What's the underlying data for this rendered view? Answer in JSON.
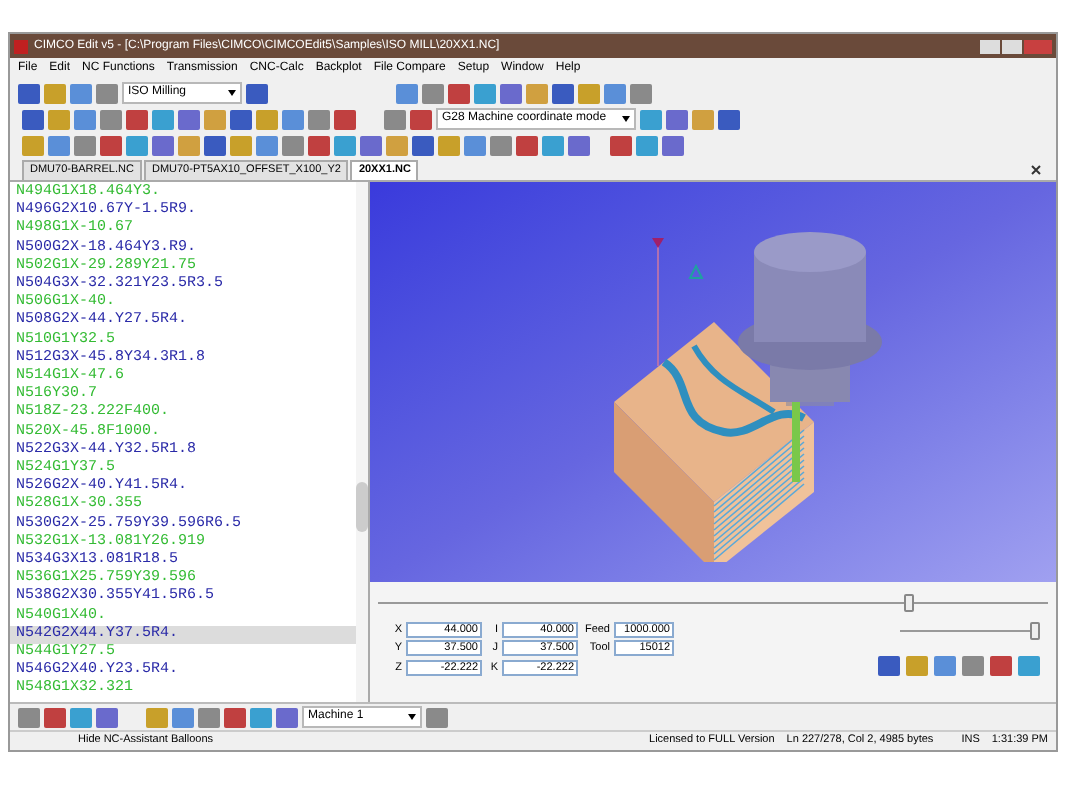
{
  "window": {
    "title": "CIMCO Edit v5 - [C:\\Program Files\\CIMCO\\CIMCOEdit5\\Samples\\ISO MILL\\20XX1.NC]"
  },
  "menu": [
    "File",
    "Edit",
    "NC Functions",
    "Transmission",
    "CNC-Calc",
    "Backplot",
    "File Compare",
    "Setup",
    "Window",
    "Help"
  ],
  "toolbar": {
    "machine_type": "ISO Milling",
    "coordinate_mode": "G28 Machine coordinate mode"
  },
  "tabs": [
    {
      "label": "DMU70-BARREL.NC",
      "selected": false
    },
    {
      "label": "DMU70-PT5AX10_OFFSET_X100_Y2",
      "selected": false
    },
    {
      "label": "20XX1.NC",
      "selected": true
    }
  ],
  "code_lines": [
    {
      "text": "N494G1X18.464Y3.",
      "color": "#33bb33",
      "selected": false
    },
    {
      "text": "N496G2X10.67Y-1.5R9.",
      "color": "#2a2aa8",
      "selected": false
    },
    {
      "text": "N498G1X-10.67",
      "color": "#33bb33",
      "selected": false
    },
    {
      "text": "N500G2X-18.464Y3.R9.",
      "color": "#2a2aa8",
      "selected": false
    },
    {
      "text": "N502G1X-29.289Y21.75",
      "color": "#33bb33",
      "selected": false
    },
    {
      "text": "N504G3X-32.321Y23.5R3.5",
      "color": "#2a2aa8",
      "selected": false
    },
    {
      "text": "N506G1X-40.",
      "color": "#33bb33",
      "selected": false
    },
    {
      "text": "N508G2X-44.Y27.5R4.",
      "color": "#2a2aa8",
      "selected": false
    },
    {
      "text": "N510G1Y32.5",
      "color": "#33bb33",
      "selected": false
    },
    {
      "text": "N512G3X-45.8Y34.3R1.8",
      "color": "#2a2aa8",
      "selected": false
    },
    {
      "text": "N514G1X-47.6",
      "color": "#33bb33",
      "selected": false
    },
    {
      "text": "N516Y30.7",
      "color": "#33bb33",
      "selected": false
    },
    {
      "text": "N518Z-23.222F400.",
      "color": "#33bb33",
      "selected": false
    },
    {
      "text": "N520X-45.8F1000.",
      "color": "#33bb33",
      "selected": false
    },
    {
      "text": "N522G3X-44.Y32.5R1.8",
      "color": "#2a2aa8",
      "selected": false
    },
    {
      "text": "N524G1Y37.5",
      "color": "#33bb33",
      "selected": false
    },
    {
      "text": "N526G2X-40.Y41.5R4.",
      "color": "#2a2aa8",
      "selected": false
    },
    {
      "text": "N528G1X-30.355",
      "color": "#33bb33",
      "selected": false
    },
    {
      "text": "N530G2X-25.759Y39.596R6.5",
      "color": "#2a2aa8",
      "selected": false
    },
    {
      "text": "N532G1X-13.081Y26.919",
      "color": "#33bb33",
      "selected": false
    },
    {
      "text": "N534G3X13.081R18.5",
      "color": "#2a2aa8",
      "selected": false
    },
    {
      "text": "N536G1X25.759Y39.596",
      "color": "#33bb33",
      "selected": false
    },
    {
      "text": "N538G2X30.355Y41.5R6.5",
      "color": "#2a2aa8",
      "selected": false
    },
    {
      "text": "N540G1X40.",
      "color": "#33bb33",
      "selected": false
    },
    {
      "text": "N542G2X44.Y37.5R4.",
      "color": "#2a2aa8",
      "selected": true
    },
    {
      "text": "N544G1Y27.5",
      "color": "#33bb33",
      "selected": false
    },
    {
      "text": "N546G2X40.Y23.5R4.",
      "color": "#2a2aa8",
      "selected": false
    },
    {
      "text": "N548G1X32.321",
      "color": "#33bb33",
      "selected": false
    }
  ],
  "coordinates": [
    {
      "label": "X",
      "value": "44.000"
    },
    {
      "label": "I",
      "value": "40.000"
    },
    {
      "label": "Feed",
      "value": "1000.000"
    },
    {
      "label": "Y",
      "value": "37.500"
    },
    {
      "label": "J",
      "value": "37.500"
    },
    {
      "label": "Tool",
      "value": "15012"
    },
    {
      "label": "Z",
      "value": "-22.222"
    },
    {
      "label": "K",
      "value": "-22.222"
    }
  ],
  "position_slider": {
    "level": 0.8
  },
  "speed_slider": {
    "level": 1.0
  },
  "bottom_toolbar": {
    "machine": "Machine 1"
  },
  "status_bar": {
    "hint": "Hide NC-Assistant Balloons",
    "license": "Licensed to FULL Version",
    "position": "Ln 227/278, Col 2, 4985 bytes",
    "mode": "INS",
    "time": "1:31:39 PM"
  }
}
